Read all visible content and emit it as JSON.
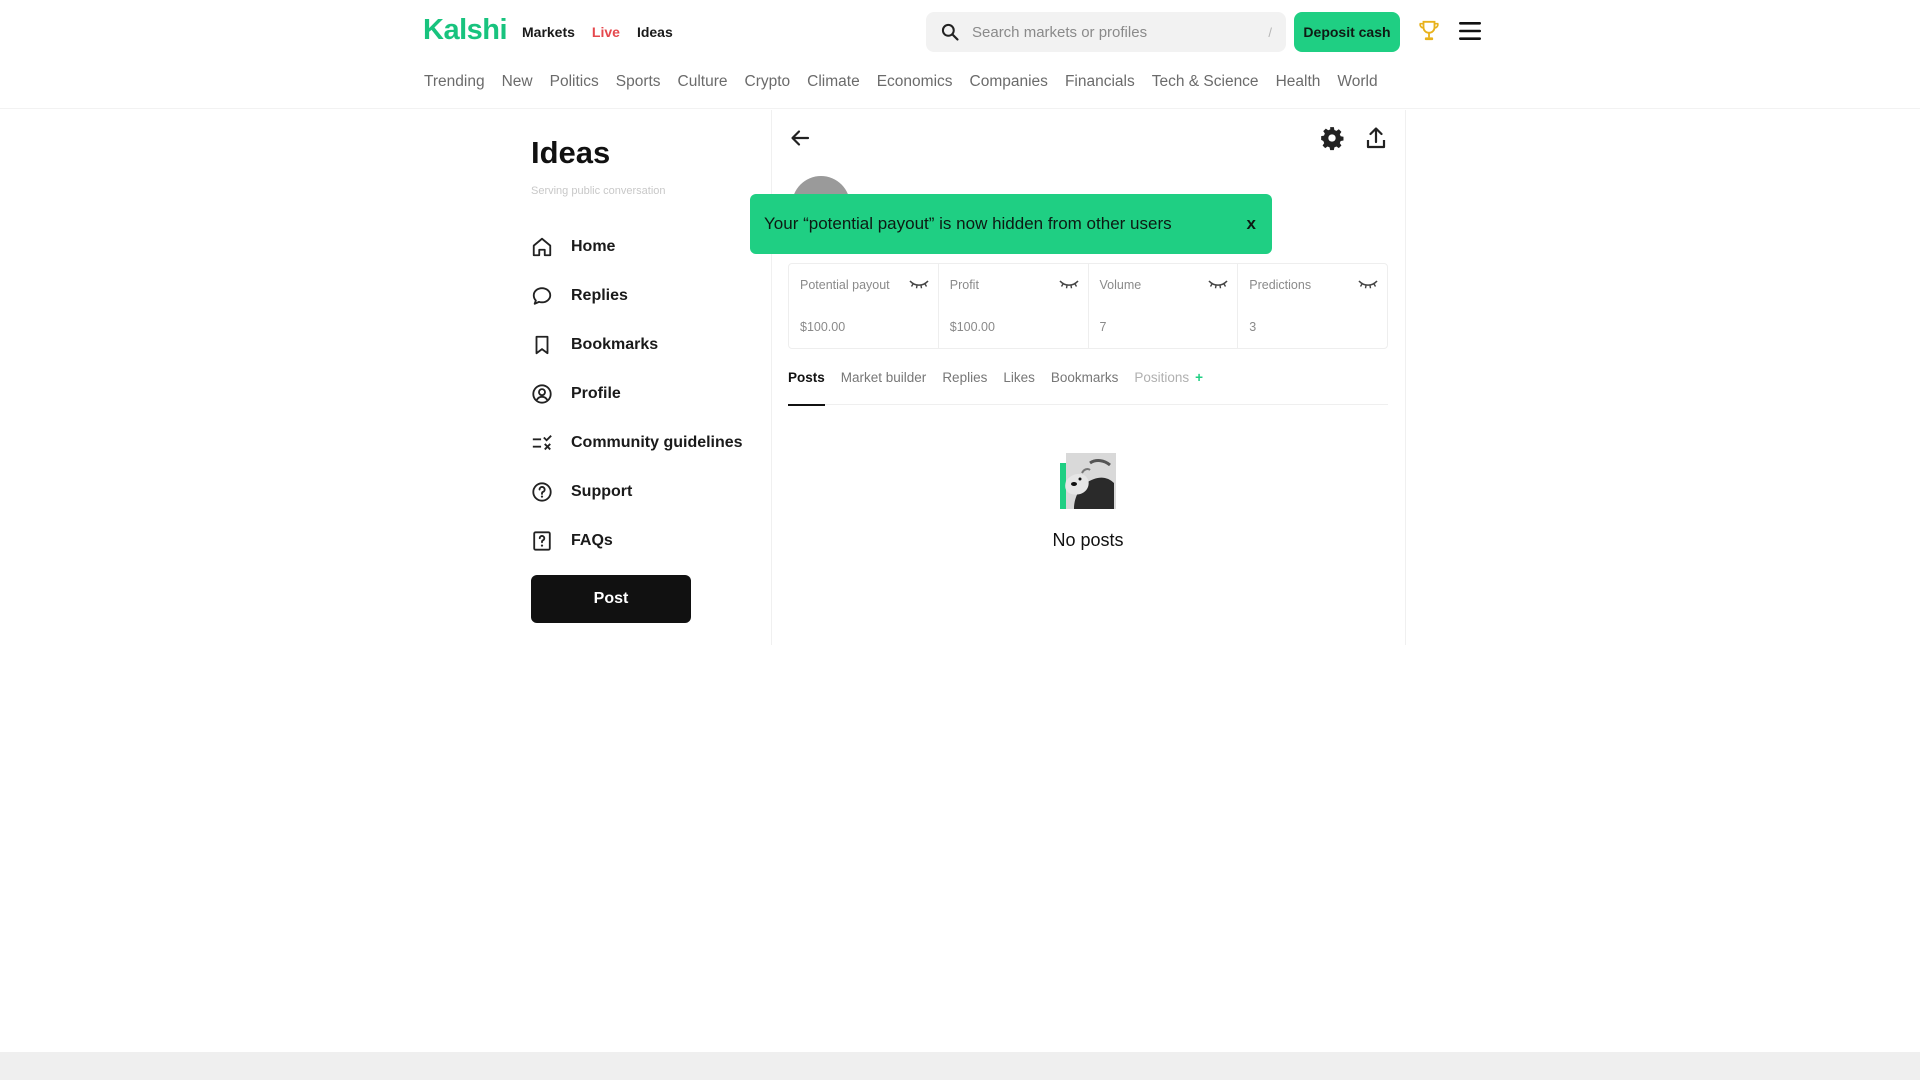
{
  "header": {
    "logo": "Kalshi",
    "nav": [
      "Markets",
      "Live",
      "Ideas"
    ],
    "search_placeholder": "Search markets or profiles",
    "search_shortcut": "/",
    "deposit_label": "Deposit cash",
    "colors": {
      "brand": "#18c37e",
      "accent": "#1fcf83",
      "live": "#e5484d"
    }
  },
  "categories": [
    "Trending",
    "New",
    "Politics",
    "Sports",
    "Culture",
    "Crypto",
    "Climate",
    "Economics",
    "Companies",
    "Financials",
    "Tech & Science",
    "Health",
    "World"
  ],
  "sidebar": {
    "title": "Ideas",
    "subtitle": "Serving public conversation",
    "items": [
      {
        "label": "Home",
        "icon": "home-icon"
      },
      {
        "label": "Replies",
        "icon": "speech-bubble-icon"
      },
      {
        "label": "Bookmarks",
        "icon": "bookmark-icon"
      },
      {
        "label": "Profile",
        "icon": "user-circle-icon"
      },
      {
        "label": "Community guidelines",
        "icon": "guidelines-icon"
      },
      {
        "label": "Support",
        "icon": "question-circle-icon"
      },
      {
        "label": "FAQs",
        "icon": "question-square-icon"
      }
    ],
    "post_label": "Post"
  },
  "toast": {
    "message": "Your “potential payout” is now hidden from other users",
    "close": "x"
  },
  "stats": [
    {
      "label": "Potential payout",
      "value": "$100.00"
    },
    {
      "label": "Profit",
      "value": "$100.00"
    },
    {
      "label": "Volume",
      "value": "7"
    },
    {
      "label": "Predictions",
      "value": "3"
    }
  ],
  "tabs": {
    "items": [
      "Posts",
      "Market builder",
      "Replies",
      "Likes",
      "Bookmarks",
      "Positions"
    ],
    "plus": "+"
  },
  "empty": {
    "text": "No posts"
  }
}
